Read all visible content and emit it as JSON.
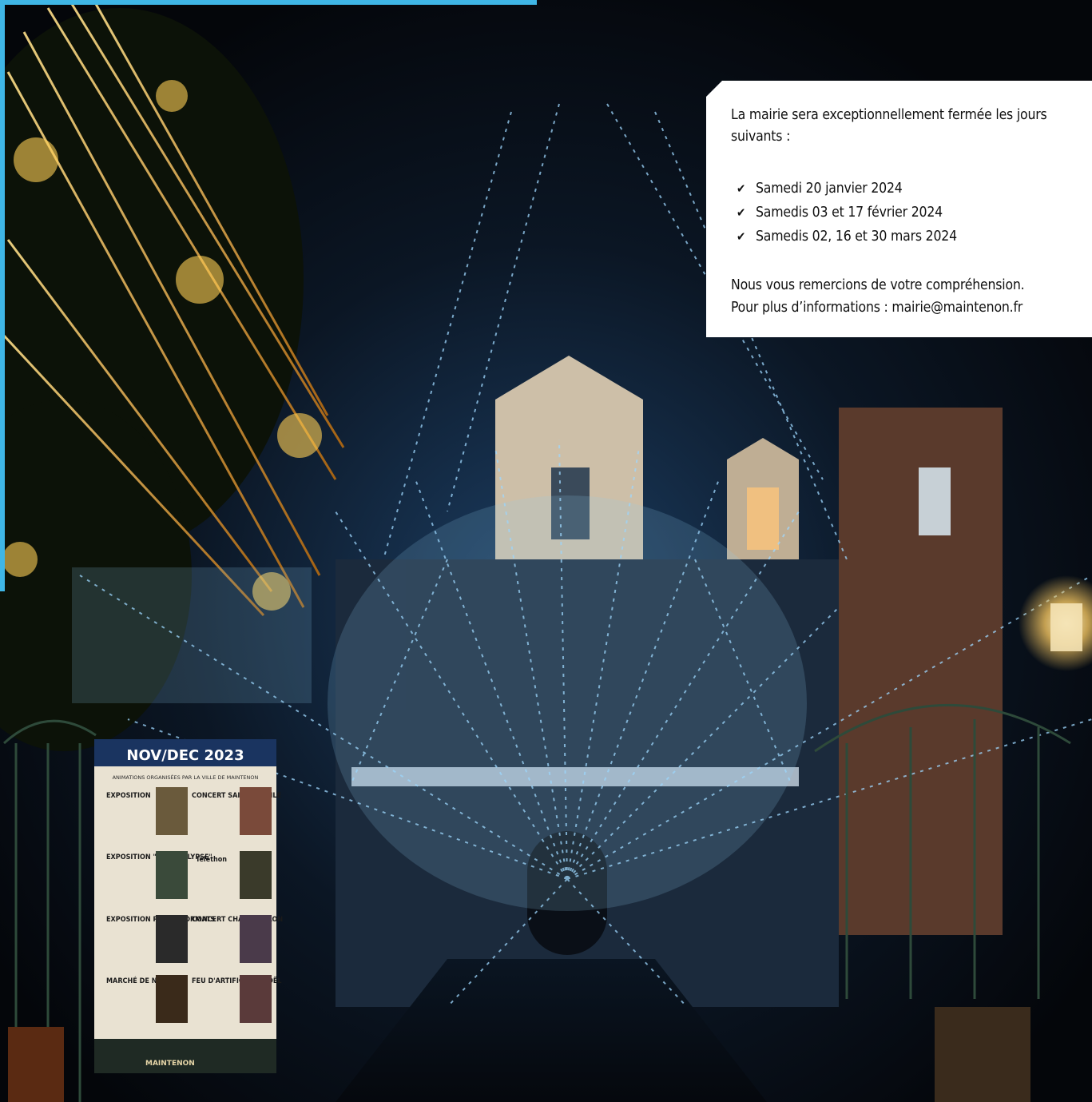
{
  "notice": {
    "intro": "La mairie sera exceptionnellement fermée les jours suivants :",
    "check_icon": "check-icon",
    "dates": [
      "Samedi 20 janvier 2024",
      "Samedis 03 et 17 février 2024",
      "Samedis 02, 16 et 30 mars 2024"
    ],
    "thanks": "Nous vous remercions de votre compréhension.",
    "contact": "Pour plus d’informations : mairie@maintenon.fr"
  },
  "poster": {
    "header": "NOV/DEC 2023",
    "subheader": "ANIMATIONS ORGANISÉES PAR LA VILLE DE MAINTENON",
    "events": [
      "EXPOSITION",
      "CONCERT SAINTE CECILE",
      "EXPOSITION \"L'APOCALYPSE\"",
      "Téléthon",
      "EXPOSITION PETITS FORMATS",
      "CONCERT CHANT/VIOLON",
      "MARCHÉ DE NOËL",
      "FEU D'ARTIFICE DE NOËL"
    ],
    "footer": "MAINTENON"
  },
  "colors": {
    "accent": "#3fb6e6",
    "sky": "#07090f",
    "lights_blue": "#9fd8ff",
    "lights_gold": "#ffc94a",
    "card": "#ffffff"
  }
}
